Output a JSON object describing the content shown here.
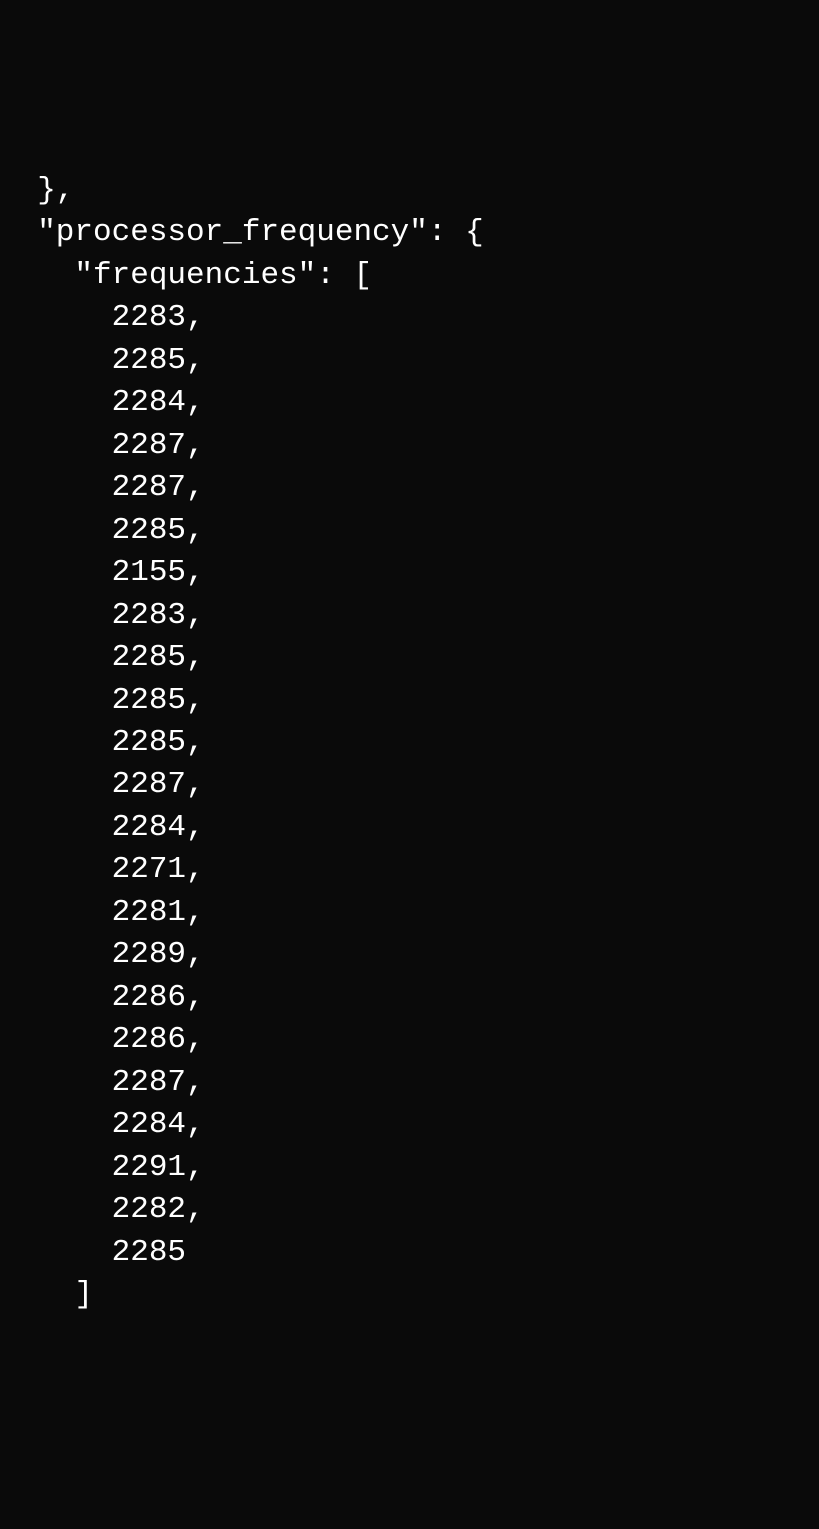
{
  "code": {
    "line1": "  },",
    "line2": "  \"processor_frequency\": {",
    "line3": "    \"frequencies\": [",
    "indent_value": "      ",
    "indent_close": "    ",
    "array_close": "]",
    "frequencies": [
      2283,
      2285,
      2284,
      2287,
      2287,
      2285,
      2155,
      2283,
      2285,
      2285,
      2285,
      2287,
      2284,
      2271,
      2281,
      2289,
      2286,
      2286,
      2287,
      2284,
      2291,
      2282,
      2285
    ]
  }
}
